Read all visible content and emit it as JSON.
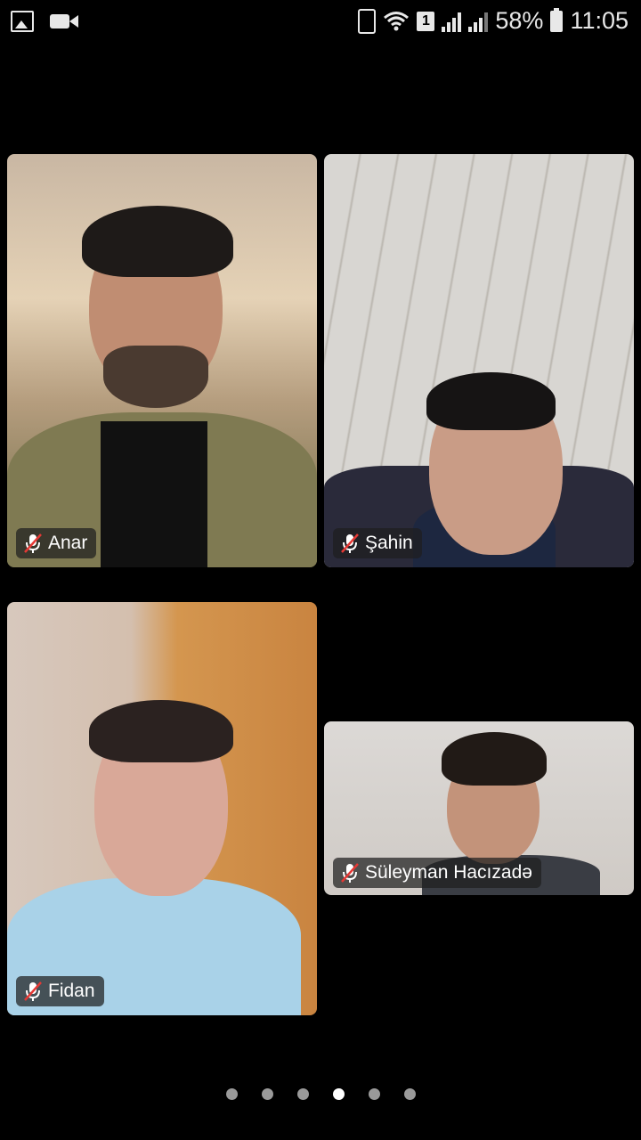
{
  "status_bar": {
    "left_icons": [
      "image-icon",
      "video-camera-icon"
    ],
    "sim_badge": "1",
    "battery_percent": "58%",
    "time": "11:05"
  },
  "participants": [
    {
      "name": "Anar",
      "muted": true
    },
    {
      "name": "Şahin",
      "muted": true
    },
    {
      "name": "Fidan",
      "muted": true
    },
    {
      "name": "Süleyman Hacızadə",
      "muted": true
    }
  ],
  "pagination": {
    "total_pages": 6,
    "current_page": 4
  }
}
